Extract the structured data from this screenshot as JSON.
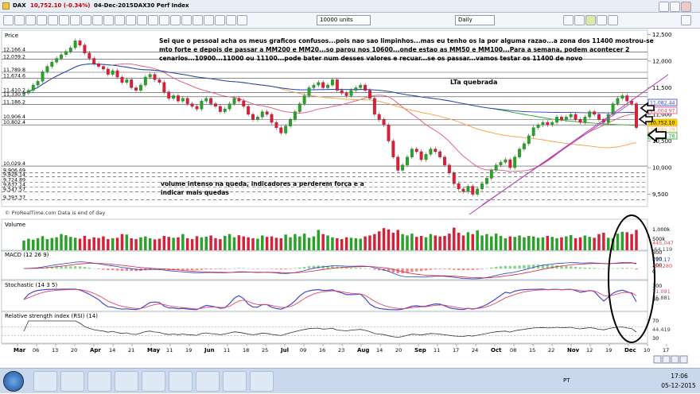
{
  "window": {
    "symbol": "DAX",
    "last": "10,752.10 (-0.34%)",
    "date": "04-Dec-2015",
    "compare": "DAX30 Perf Index",
    "units": "10000 units",
    "period": "Daily"
  },
  "panels": {
    "price": "Price",
    "source": "© ProRealTime.com  Data is end of day",
    "volume": "Volume",
    "macd": "MACD (12 26 9)",
    "stoch": "Stochastic (14 3 5)",
    "rsi": "Relative strength index (RSI) (14)"
  },
  "annotations": {
    "comment_lines": [
      "Sei que o pessoal acha os meus graficos confusos...pois nao sao limpinhos...mas eu tenho os la por alguma razao...a zona dos 11400 mostrou-se",
      "mto forte e depois de passar a MM200 e MM20...so parou nos 10600...onde estao as MM50 e MM100...Para a semana, podem acontecer 2",
      "cenarios...10900...11000 ou 11100...pode bater num desses valores e recuar...se os passar...vamos testar os 11400 de novo"
    ],
    "trendline_label": "LTa quebrada",
    "volume_lines": [
      "volume intenso na queda, indicadores a perderem força e a",
      "indicar mais quedas"
    ]
  },
  "chart_data": {
    "type": "candlestick",
    "ylim": [
      9300,
      12550
    ],
    "x_tick_labels": [
      "Mar",
      "06",
      "13",
      "20",
      "Apr",
      "14",
      "21",
      "May",
      "11",
      "19",
      "Jun",
      "11",
      "18",
      "25",
      "Jul",
      "09",
      "16",
      "23",
      "Aug",
      "14",
      "20",
      "Sep",
      "11",
      "17",
      "24",
      "Oct",
      "08",
      "15",
      "22",
      "Nov",
      "12",
      "19",
      "Dec",
      "10",
      "17"
    ],
    "y_axis_labels": [
      "12,500",
      "12,000",
      "11,500",
      "11,000",
      "10,500",
      "10,000",
      "9,500"
    ],
    "y_axis_values": [
      12500,
      12000,
      11500,
      11000,
      10500,
      10000,
      9500
    ],
    "horizontal_level_labels": [
      "12,166.4",
      "12,039.2",
      "11,789.8",
      "11,674.6",
      "11,410.2",
      "11,330.3",
      "11,186.2",
      "10,906.4",
      "10,802.4",
      "10,029.4",
      "9,906.69",
      "9,828.14",
      "9,724.89",
      "9,637.14",
      "9,547.57",
      "9,393.37"
    ],
    "horizontal_levels": [
      12166.4,
      12039.2,
      11789.8,
      11674.6,
      11410.2,
      11330.3,
      11186.2,
      10906.4,
      10802.4,
      10029.4,
      9906.69,
      9828.14,
      9724.89,
      9637.14,
      9547.57,
      9393.37
    ],
    "right_badges": [
      {
        "text": "11,082.44",
        "color": "#2d3ec8"
      },
      {
        "text": "11,004.97",
        "color": "#d9446b"
      },
      {
        "text": "10,752.10",
        "color": "#e8b400"
      },
      {
        "text": "10,685.28",
        "color": "#ffb36b"
      },
      {
        "text": "10,663.78",
        "color": "#27a827"
      }
    ],
    "closes": [
      11400,
      11450,
      11550,
      11620,
      11800,
      11900,
      11980,
      12050,
      12120,
      12180,
      12250,
      12380,
      12300,
      12150,
      12050,
      11950,
      11900,
      11850,
      11750,
      11820,
      11700,
      11600,
      11650,
      11500,
      11450,
      11550,
      11700,
      11750,
      11650,
      11600,
      11420,
      11300,
      11350,
      11250,
      11300,
      11200,
      11150,
      11100,
      11250,
      11300,
      11200,
      11150,
      11050,
      11100,
      11200,
      11300,
      11250,
      11150,
      11000,
      10900,
      10950,
      11050,
      11000,
      10850,
      10750,
      10650,
      10780,
      10900,
      11050,
      11200,
      11350,
      11500,
      11550,
      11600,
      11500,
      11550,
      11650,
      11450,
      11400,
      11350,
      11450,
      11500,
      11550,
      11450,
      11300,
      11000,
      10900,
      10800,
      10500,
      10200,
      9950,
      10050,
      10200,
      10350,
      10300,
      10150,
      10250,
      10350,
      10300,
      10200,
      10050,
      9900,
      9700,
      9600,
      9550,
      9650,
      9500,
      9600,
      9700,
      9800,
      9950,
      10050,
      10100,
      10150,
      10000,
      10200,
      10350,
      10450,
      10600,
      10750,
      10800,
      10850,
      10800,
      10850,
      10950,
      10900,
      10950,
      11000,
      10900,
      10850,
      10950,
      11050,
      11000,
      10900,
      10850,
      11000,
      11200,
      11300,
      11350,
      11250,
      11200,
      10752
    ],
    "volume": [
      420,
      500,
      460,
      520,
      610,
      480,
      530,
      560,
      700,
      650,
      580,
      540,
      500,
      620,
      480,
      560,
      530,
      600,
      480,
      520,
      540,
      700,
      680,
      520,
      480,
      560,
      600,
      520,
      470,
      500,
      620,
      580,
      540,
      560,
      700,
      520,
      480,
      610,
      560,
      590,
      640,
      520,
      480,
      620,
      700,
      560,
      650,
      600,
      560,
      520,
      500,
      640,
      580,
      600,
      540,
      520,
      680,
      560,
      700,
      600,
      720,
      540,
      600,
      880,
      700,
      640,
      560,
      520,
      480,
      560,
      540,
      520,
      500,
      600,
      640,
      700,
      820,
      960,
      900,
      760,
      880,
      700,
      640,
      720,
      580,
      620,
      560,
      700,
      640,
      600,
      620,
      720,
      980,
      760,
      640,
      780,
      700,
      860,
      640,
      700,
      600,
      720,
      620,
      520,
      600,
      580,
      640,
      560,
      620,
      600,
      540,
      560,
      620,
      580,
      520,
      560,
      600,
      660,
      520,
      560,
      640,
      580,
      540,
      700,
      760,
      540,
      520,
      720,
      800,
      780,
      700,
      880
    ],
    "volume_ylim": [
      0,
      1000
    ],
    "volume_tick_labels": [
      "1,000k",
      "500k"
    ],
    "volume_badges": [
      {
        "text": "445,047",
        "color": "#e04848"
      },
      {
        "text": "-64,119",
        "color": "#444"
      }
    ],
    "macd_tick_labels": [
      "300",
      "200",
      "100",
      "0"
    ],
    "macd_badges": [
      {
        "text": "110.17",
        "color": "#2d3ec8"
      },
      {
        "text": "-38,280",
        "color": "#e04848"
      }
    ],
    "stoch_tick_labels": [
      "100",
      "50"
    ],
    "stoch_badges": [
      {
        "text": "71.091",
        "color": "#d9446b"
      },
      {
        "text": "35.881",
        "color": "#444"
      }
    ],
    "rsi_tick_labels": [
      "70",
      "30"
    ],
    "rsi_badges": [
      {
        "text": "44.419",
        "color": "#444"
      }
    ]
  },
  "taskbar": {
    "lang": "PT",
    "time": "17:06",
    "date": "05-12-2015"
  }
}
